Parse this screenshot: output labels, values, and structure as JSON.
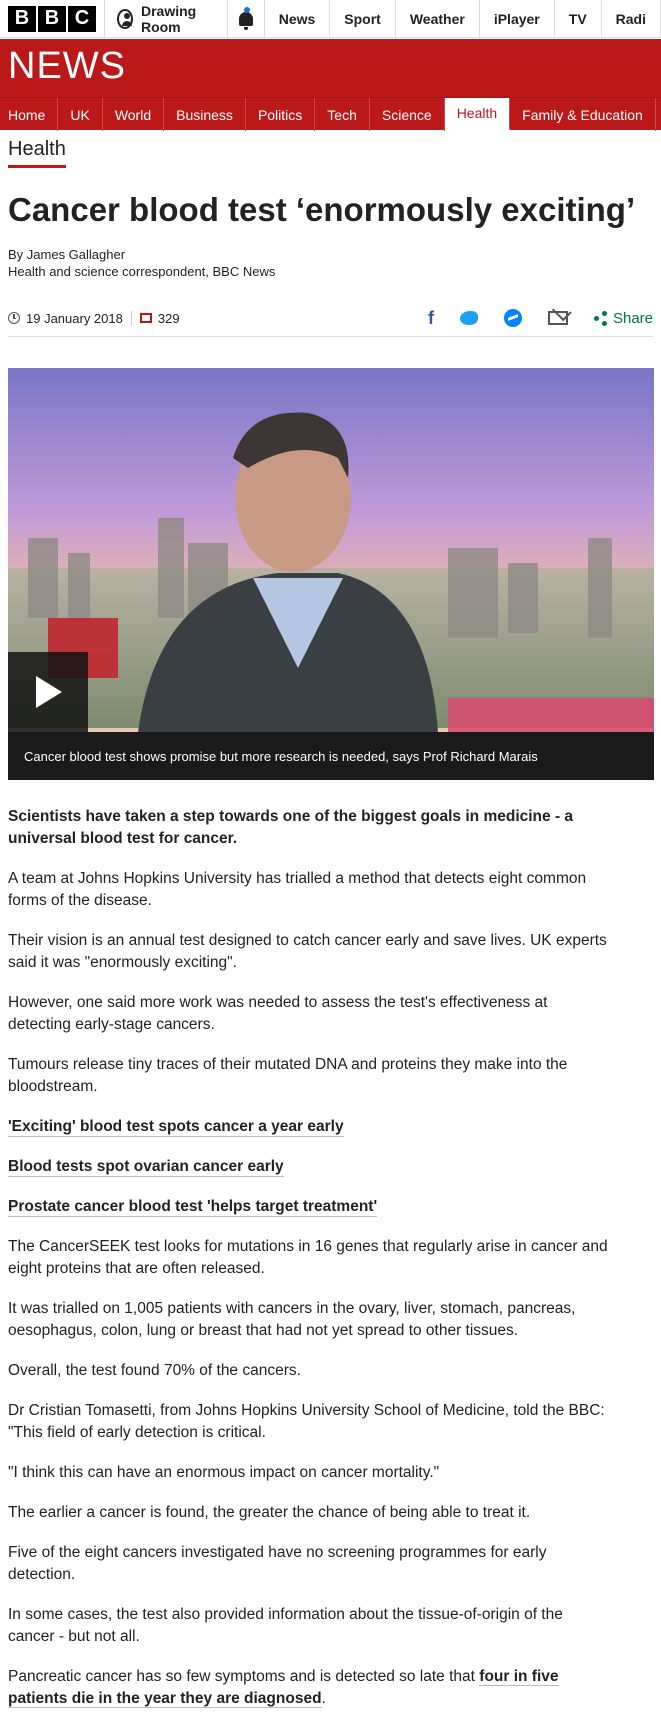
{
  "global_nav": {
    "brand_letters": [
      "B",
      "B",
      "C"
    ],
    "signin_label": "Drawing Room",
    "links": [
      "News",
      "Sport",
      "Weather",
      "iPlayer",
      "TV",
      "Radi"
    ]
  },
  "banner": {
    "title": "NEWS"
  },
  "section_nav": {
    "items": [
      "Home",
      "UK",
      "World",
      "Business",
      "Politics",
      "Tech",
      "Science",
      "Health",
      "Family & Education"
    ],
    "active": "Health"
  },
  "section_label": "Health",
  "article": {
    "headline": "Cancer blood test ‘enormously exciting’",
    "byline_name": "By James Gallagher",
    "byline_role": "Health and science correspondent, BBC News",
    "date": "19 January 2018",
    "comment_count": "329",
    "share_label": "Share"
  },
  "media": {
    "caption": "Cancer blood test shows promise but more research is needed, says Prof Richard Marais"
  },
  "body": {
    "intro": "Scientists have taken a step towards one of the biggest goals in medicine - a universal blood test for cancer.",
    "p1": "A team at Johns Hopkins University has trialled a method that detects eight common forms of the disease.",
    "p2": "Their vision is an annual test designed to catch cancer early and save lives. UK experts said it was \"enormously exciting\".",
    "p3": "However, one said more work was needed to assess the test's effectiveness at detecting early-stage cancers.",
    "p4": "Tumours release tiny traces of their mutated DNA and proteins they make into the bloodstream.",
    "link1": "'Exciting' blood test spots cancer a year early",
    "link2": "Blood tests spot ovarian cancer early",
    "link3": "Prostate cancer blood test 'helps target treatment'",
    "p5": "The CancerSEEK test looks for mutations in 16 genes that regularly arise in cancer and eight proteins that are often released.",
    "p6": "It was trialled on 1,005 patients with cancers in the ovary, liver, stomach, pancreas, oesophagus, colon, lung or breast that had not yet spread to other tissues.",
    "p7": "Overall, the test found 70% of the cancers.",
    "p8": "Dr Cristian Tomasetti, from Johns Hopkins University School of Medicine, told the BBC: \"This field of early detection is critical.",
    "p9": "\"I think this can have an enormous impact on cancer mortality.\"",
    "p10": "The earlier a cancer is found, the greater the chance of being able to treat it.",
    "p11": "Five of the eight cancers investigated have no screening programmes for early detection.",
    "p12": "In some cases, the test also provided information about the tissue-of-origin of the cancer - but not all.",
    "p13_start": "Pancreatic cancer has so few symptoms and is detected so late that ",
    "p13_link": "four in five patients die in the year they are diagnosed",
    "p13_end": "."
  },
  "colors": {
    "brand_red": "#bb1919",
    "share_green": "#00754c",
    "facebook_blue": "#3b5998",
    "twitter_blue": "#1da1f2"
  }
}
